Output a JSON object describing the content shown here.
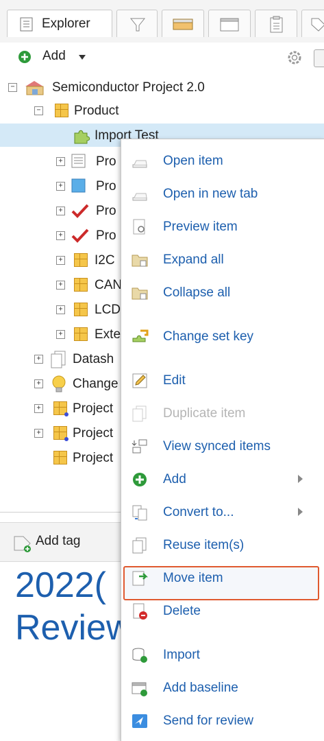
{
  "tabs": [
    {
      "label": "Explorer",
      "icon": "explorer-icon",
      "active": true
    },
    {
      "label": "",
      "icon": "filter-icon",
      "active": false
    },
    {
      "label": "",
      "icon": "ruler-icon",
      "active": false
    },
    {
      "label": "",
      "icon": "window-icon",
      "active": false
    },
    {
      "label": "",
      "icon": "clipboard-icon",
      "active": false
    },
    {
      "label": "",
      "icon": "tag-icon",
      "active": false
    }
  ],
  "toolbar": {
    "add_label": "Add"
  },
  "tree": {
    "root": "Semiconductor Project 2.0",
    "product": "Product",
    "import_test": "Import Test",
    "children": [
      "Pro",
      "Pro",
      "Pro",
      "Pro",
      "I2C",
      "CAN",
      "LCD",
      "Exte"
    ],
    "datasheet": "Datash",
    "change": "Change",
    "project1": "Project",
    "project2": "Project",
    "project3": "Project"
  },
  "bottom": {
    "add_tag": "Add tag",
    "big_line1": "2022(",
    "big_line2": "Review"
  },
  "menu": {
    "items": [
      {
        "label": "Open item",
        "icon": "open-item-icon",
        "enabled": true
      },
      {
        "label": "Open in new tab",
        "icon": "open-new-tab-icon",
        "enabled": true
      },
      {
        "label": "Preview item",
        "icon": "preview-icon",
        "enabled": true
      },
      {
        "label": "Expand all",
        "icon": "expand-all-icon",
        "enabled": true
      },
      {
        "label": "Collapse all",
        "icon": "collapse-all-icon",
        "enabled": true
      },
      {
        "label": "Change set key",
        "icon": "change-set-key-icon",
        "enabled": true
      },
      {
        "label": "Edit",
        "icon": "pencil-icon",
        "enabled": true
      },
      {
        "label": "Duplicate item",
        "icon": "duplicate-icon",
        "enabled": false
      },
      {
        "label": "View synced items",
        "icon": "synced-items-icon",
        "enabled": true,
        "highlighted": true
      },
      {
        "label": "Add",
        "icon": "add-icon",
        "enabled": true,
        "submenu": true
      },
      {
        "label": "Convert to...",
        "icon": "convert-icon",
        "enabled": true,
        "submenu": true
      },
      {
        "label": "Reuse item(s)",
        "icon": "reuse-icon",
        "enabled": true
      },
      {
        "label": "Move item",
        "icon": "move-icon",
        "enabled": true
      },
      {
        "label": "Delete",
        "icon": "delete-icon",
        "enabled": true
      },
      {
        "label": "Import",
        "icon": "import-icon",
        "enabled": true
      },
      {
        "label": "Add baseline",
        "icon": "add-baseline-icon",
        "enabled": true
      },
      {
        "label": "Send for review",
        "icon": "send-review-icon",
        "enabled": true
      }
    ]
  },
  "colors": {
    "link": "#1d5fae",
    "accent_highlight": "#e0592f",
    "selection": "#d4e9f7",
    "green": "#2e9a3a"
  }
}
